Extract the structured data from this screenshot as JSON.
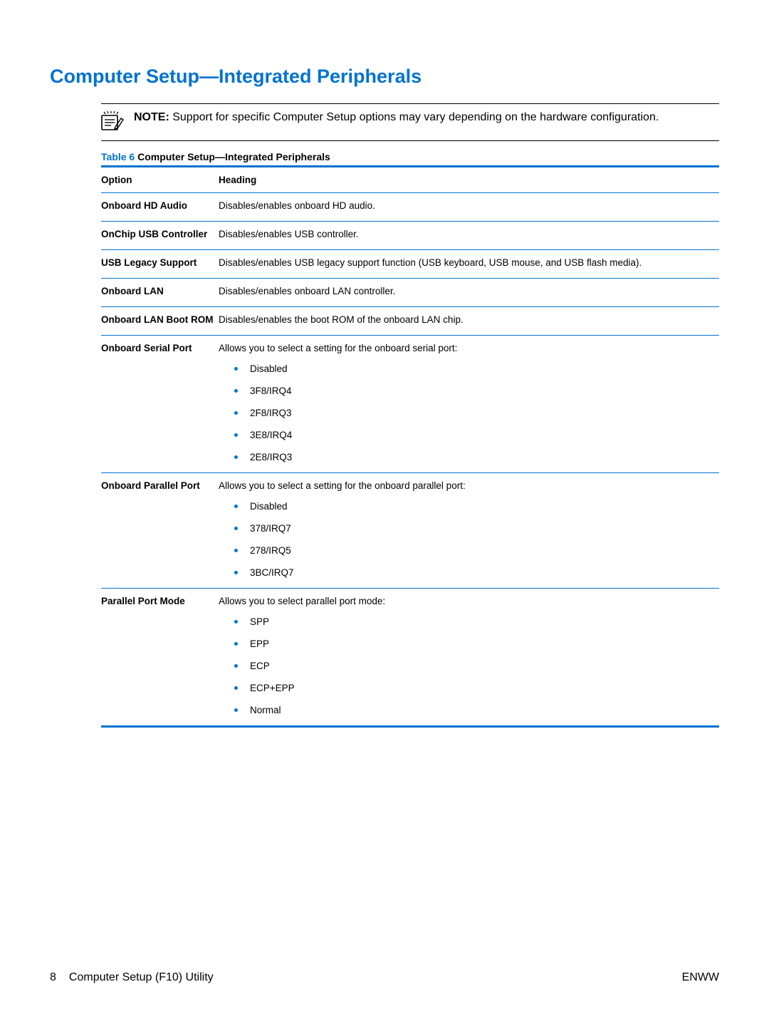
{
  "title": "Computer Setup—Integrated Peripherals",
  "note": {
    "label": "NOTE:",
    "text": "Support for specific Computer Setup options may vary depending on the hardware configuration."
  },
  "table": {
    "caption_prefix": "Table 6",
    "caption_text": "  Computer Setup—Integrated Peripherals",
    "headers": {
      "option": "Option",
      "heading": "Heading"
    },
    "rows": [
      {
        "option": "Onboard HD Audio",
        "desc": "Disables/enables onboard HD audio.",
        "items": []
      },
      {
        "option": "OnChip USB Controller",
        "desc": "Disables/enables USB controller.",
        "items": []
      },
      {
        "option": "USB Legacy Support",
        "desc": "Disables/enables USB legacy support function (USB keyboard, USB mouse, and USB flash media).",
        "items": []
      },
      {
        "option": "Onboard LAN",
        "desc": "Disables/enables onboard LAN controller.",
        "items": []
      },
      {
        "option": "Onboard LAN Boot ROM",
        "desc": "Disables/enables the boot ROM of the onboard LAN chip.",
        "items": []
      },
      {
        "option": "Onboard Serial Port",
        "desc": "Allows you to select a setting for the onboard serial port:",
        "items": [
          "Disabled",
          "3F8/IRQ4",
          "2F8/IRQ3",
          "3E8/IRQ4",
          "2E8/IRQ3"
        ]
      },
      {
        "option": "Onboard Parallel Port",
        "desc": "Allows you to select a setting for the onboard parallel port:",
        "items": [
          "Disabled",
          "378/IRQ7",
          "278/IRQ5",
          "3BC/IRQ7"
        ]
      },
      {
        "option": "Parallel Port Mode",
        "desc": "Allows you to select parallel port mode:",
        "items": [
          "SPP",
          "EPP",
          "ECP",
          "ECP+EPP",
          "Normal"
        ]
      }
    ]
  },
  "footer": {
    "page_num": "8",
    "section": "Computer Setup (F10) Utility",
    "right": "ENWW"
  }
}
